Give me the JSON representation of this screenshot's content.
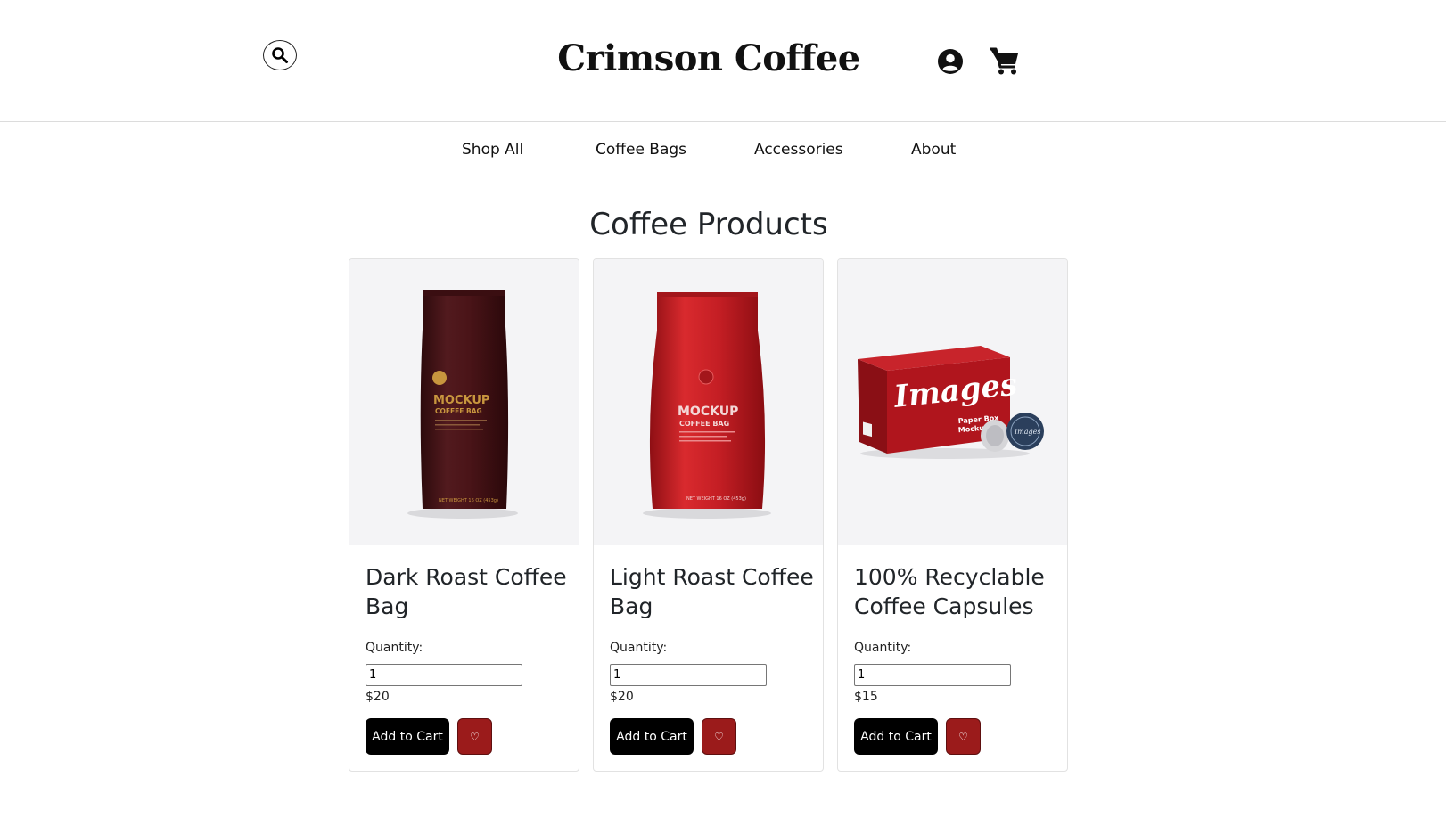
{
  "header": {
    "brand": "Crimson Coffee"
  },
  "nav": {
    "items": [
      {
        "label": "Shop All"
      },
      {
        "label": "Coffee Bags"
      },
      {
        "label": "Accessories"
      },
      {
        "label": "About"
      }
    ]
  },
  "main": {
    "title": "Coffee Products",
    "products": [
      {
        "name": "Dark Roast Coffee Bag",
        "quantity_label": "Quantity:",
        "quantity": "1",
        "price": "$20",
        "add_label": "Add to Cart",
        "fav_label": "♡",
        "image": {
          "package_text": "MOCKUP",
          "package_subtext": "COFFEE BAG",
          "color": "#4a1418",
          "label_color": "#c8963e"
        }
      },
      {
        "name": "Light Roast Coffee Bag",
        "quantity_label": "Quantity:",
        "quantity": "1",
        "price": "$20",
        "add_label": "Add to Cart",
        "fav_label": "♡",
        "image": {
          "package_text": "MOCKUP",
          "package_subtext": "COFFEE BAG",
          "color": "#c41e24",
          "label_color": "#f3d7d7"
        }
      },
      {
        "name": "100% Recyclable Coffee Capsules",
        "quantity_label": "Quantity:",
        "quantity": "1",
        "price": "$15",
        "add_label": "Add to Cart",
        "fav_label": "♡",
        "image": {
          "package_text": "Images",
          "package_subtext": "Paper Box Mockup",
          "color": "#a8141c",
          "label_color": "#ffffff"
        }
      }
    ]
  },
  "icons": {
    "search": "search-icon",
    "account": "user-circle-icon",
    "cart": "shopping-cart-icon",
    "favorite": "heart-icon"
  },
  "colors": {
    "favorite_button": "#9b1b1b",
    "add_button": "#000000",
    "image_background": "#f4f4f6"
  }
}
